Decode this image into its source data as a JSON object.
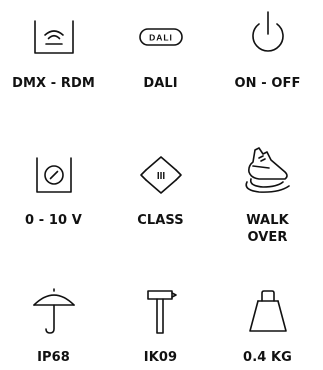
{
  "features": [
    {
      "icon": "dmx-rdm-icon",
      "label": "DMX - RDM"
    },
    {
      "icon": "dali-icon",
      "label": "DALI",
      "icon_text": "DALI"
    },
    {
      "icon": "power-icon",
      "label": "ON - OFF"
    },
    {
      "icon": "dimmer-icon",
      "label": "0 - 10 V"
    },
    {
      "icon": "class-icon",
      "label": "CLASS",
      "icon_text": "III"
    },
    {
      "icon": "walk-over-icon",
      "label": "WALK",
      "label_line2": "OVER"
    },
    {
      "icon": "umbrella-icon",
      "label": "IP68"
    },
    {
      "icon": "hammer-icon",
      "label": "IK09"
    },
    {
      "icon": "weight-icon",
      "label": "0.4 KG"
    }
  ]
}
